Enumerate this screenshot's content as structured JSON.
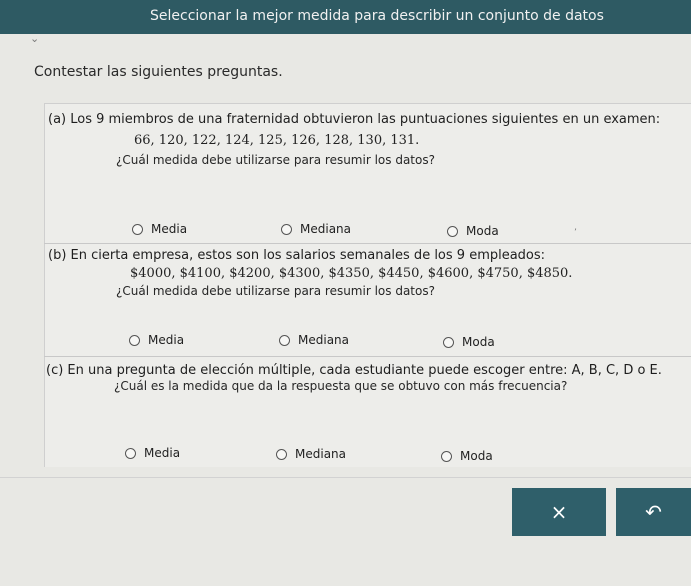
{
  "header": {
    "title": "Seleccionar la mejor medida para describir un conjunto de datos"
  },
  "instructions": "Contestar las siguientes preguntas.",
  "questions": [
    {
      "label": "(a) Los 9 miembros de una fraternidad obtuvieron las puntuaciones siguientes en un examen:",
      "data": "66, 120, 122, 124, 125, 126, 128, 130, 131.",
      "ask": "¿Cuál medida debe utilizarse para resumir los datos?",
      "options": [
        "Media",
        "Mediana",
        "Moda"
      ]
    },
    {
      "label": "(b) En cierta empresa, estos son los salarios semanales de los 9 empleados:",
      "data": "$4000, $4100, $4200, $4300, $4350, $4450, $4600, $4750, $4850.",
      "ask": "¿Cuál medida debe utilizarse para resumir los datos?",
      "options": [
        "Media",
        "Mediana",
        "Moda"
      ]
    },
    {
      "label": "(c) En una pregunta de elección múltiple, cada estudiante puede escoger entre: A, B, C, D o E.",
      "data": "",
      "ask": "¿Cuál es la medida que da la respuesta que se obtuvo con más frecuencia?",
      "options": [
        "Media",
        "Mediana",
        "Moda"
      ]
    }
  ],
  "buttons": {
    "clear_icon": "×",
    "undo_icon": "↶"
  }
}
